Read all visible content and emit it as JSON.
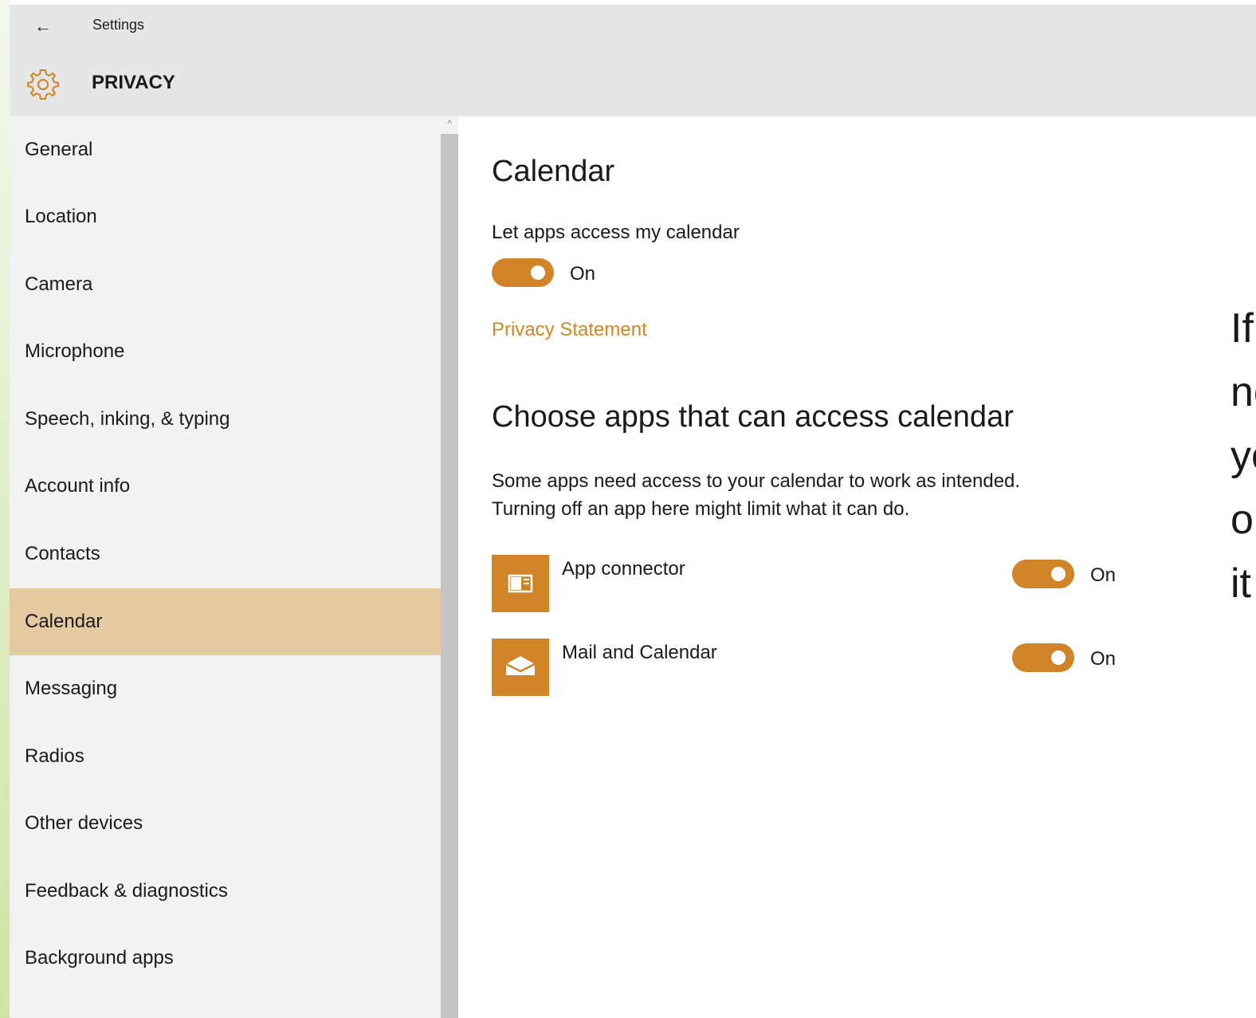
{
  "window": {
    "app_title": "Settings",
    "section_title": "PRIVACY",
    "accent_color": "#d08327",
    "selected_bg": "#e4c9a1"
  },
  "sidebar": {
    "items": [
      {
        "label": "General"
      },
      {
        "label": "Location"
      },
      {
        "label": "Camera"
      },
      {
        "label": "Microphone"
      },
      {
        "label": "Speech, inking, & typing"
      },
      {
        "label": "Account info"
      },
      {
        "label": "Contacts"
      },
      {
        "label": "Calendar",
        "selected": true
      },
      {
        "label": "Messaging"
      },
      {
        "label": "Radios"
      },
      {
        "label": "Other devices"
      },
      {
        "label": "Feedback & diagnostics"
      },
      {
        "label": "Background apps"
      }
    ]
  },
  "main": {
    "page_title": "Calendar",
    "master_label": "Let apps access my calendar",
    "master_toggle_state": "On",
    "privacy_link": "Privacy Statement",
    "apps_heading": "Choose apps that can access calendar",
    "description_line1": "Some apps need access to your calendar to work as intended.",
    "description_line2": "Turning off an app here might limit what it can do.",
    "apps": [
      {
        "name": "App connector",
        "state": "On",
        "icon": "app-connector-icon"
      },
      {
        "name": "Mail and Calendar",
        "state": "On",
        "icon": "mail-icon"
      }
    ]
  },
  "side_text": {
    "lines": [
      "If",
      "ne",
      "yo",
      "or",
      "it"
    ]
  }
}
